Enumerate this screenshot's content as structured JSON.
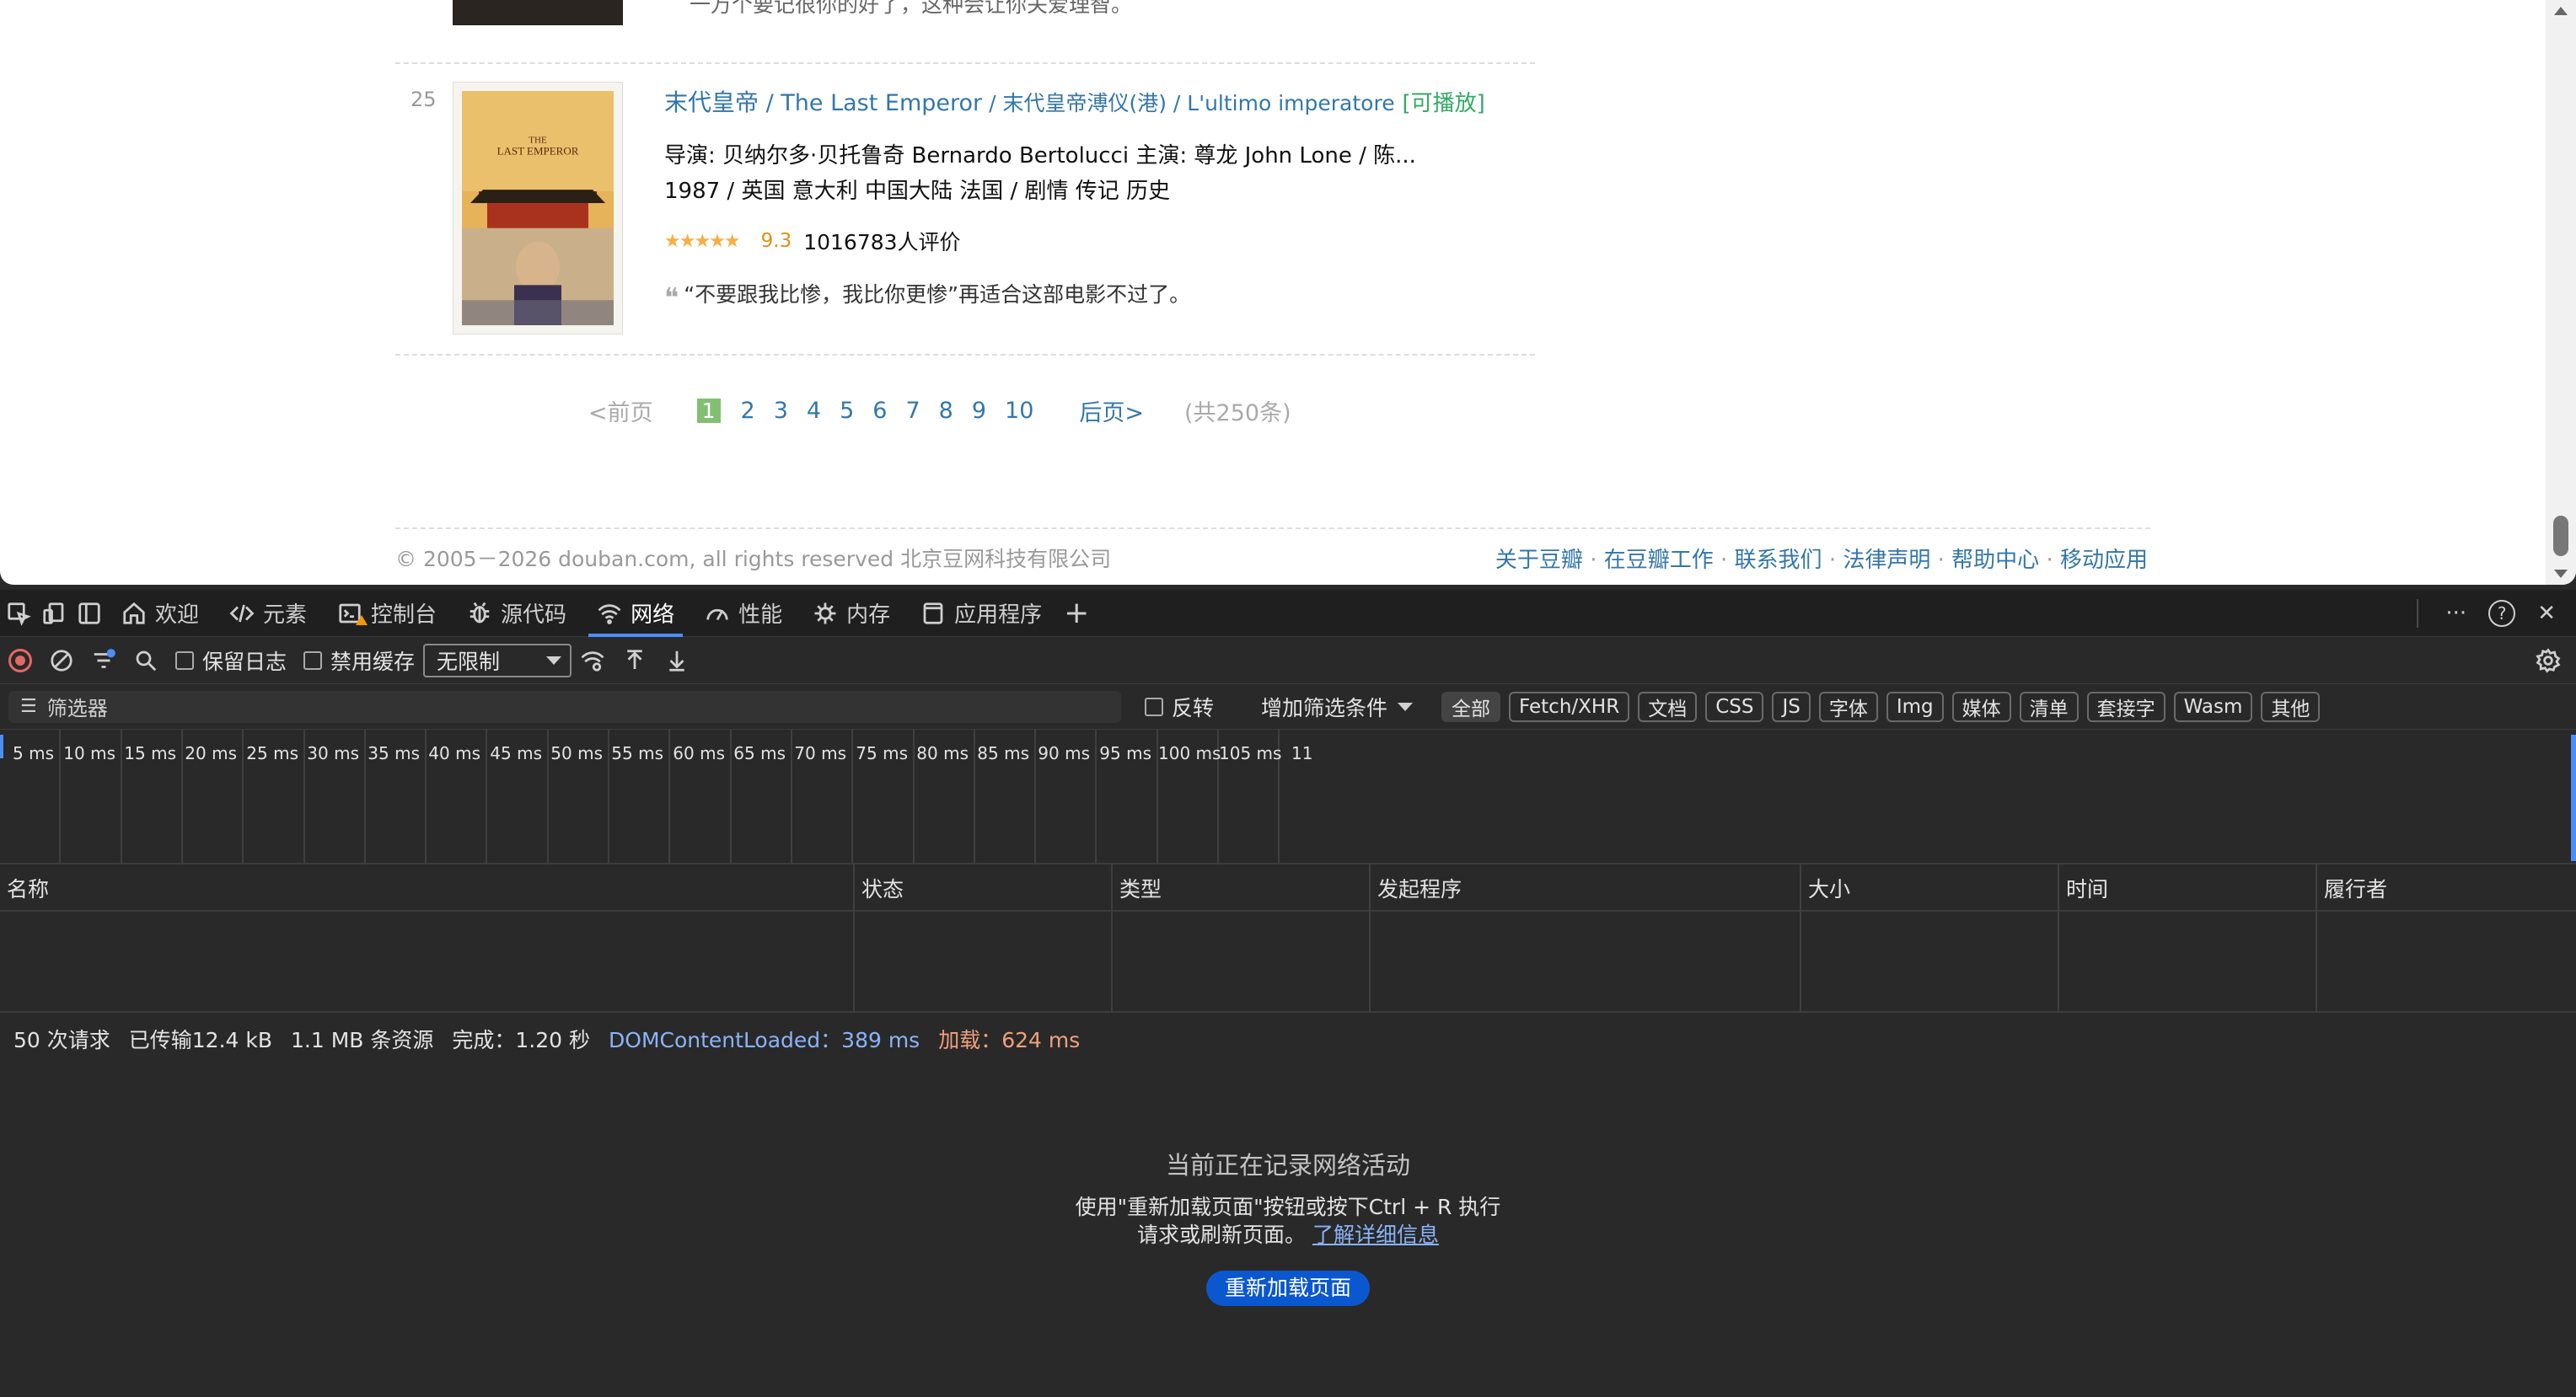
{
  "webpage": {
    "prev_item_quote": "一万个要记很你的好了，这种会让你关爱理智。",
    "item": {
      "rank": "25",
      "title_main": "末代皇帝",
      "title_alt": " / The Last Emperor",
      "title_other": " / 末代皇帝溥仪(港) / L'ultimo imperatore",
      "playable": "[可播放]",
      "director_line": "导演: 贝纳尔多·贝托鲁奇 Bernardo Bertolucci   主演: 尊龙 John Lone / 陈...",
      "meta_line": "1987 / 英国 意大利 中国大陆 法国 / 剧情 传记 历史",
      "stars": "★★★★★",
      "rating": "9.3",
      "votes": "1016783人评价",
      "quote_mark": "❝",
      "quote": "“不要跟我比惨，我比你更惨”再适合这部电影不过了。",
      "poster_text_1": "THE",
      "poster_text_2": "LAST EMPEROR"
    },
    "pager": {
      "prev": "<前页",
      "current": "1",
      "pages": [
        "2",
        "3",
        "4",
        "5",
        "6",
        "7",
        "8",
        "9",
        "10"
      ],
      "next": "后页>",
      "total": "(共250条)"
    },
    "footer": {
      "copyright": "© 2005－2026 douban.com, all rights reserved 北京豆网科技有限公司",
      "links": [
        "关于豆瓣",
        "在豆瓣工作",
        "联系我们",
        "法律声明",
        "帮助中心",
        "移动应用"
      ],
      "separator": " · "
    }
  },
  "devtools": {
    "tabs": [
      {
        "label": "欢迎",
        "icon": "home-icon"
      },
      {
        "label": "元素",
        "icon": "code-icon"
      },
      {
        "label": "控制台",
        "icon": "console-icon"
      },
      {
        "label": "源代码",
        "icon": "bug-icon"
      },
      {
        "label": "网络",
        "icon": "wifi-icon",
        "active": true
      },
      {
        "label": "性能",
        "icon": "gauge-icon"
      },
      {
        "label": "内存",
        "icon": "chip-icon"
      },
      {
        "label": "应用程序",
        "icon": "window-icon"
      }
    ],
    "add_tab": "+",
    "more": "···",
    "help": "?",
    "close": "✕",
    "toolbar": {
      "preserve_log": "保留日志",
      "disable_cache": "禁用缓存",
      "throttle": "无限制"
    },
    "filter": {
      "placeholder": "筛选器",
      "invert": "反转",
      "add_filter": "增加筛选条件",
      "chips": [
        "全部",
        "Fetch/XHR",
        "文档",
        "CSS",
        "JS",
        "字体",
        "Img",
        "媒体",
        "清单",
        "套接字",
        "Wasm",
        "其他"
      ]
    },
    "timeline_ticks": [
      "5 ms",
      "10 ms",
      "15 ms",
      "20 ms",
      "25 ms",
      "30 ms",
      "35 ms",
      "40 ms",
      "45 ms",
      "50 ms",
      "55 ms",
      "60 ms",
      "65 ms",
      "70 ms",
      "75 ms",
      "80 ms",
      "85 ms",
      "90 ms",
      "95 ms",
      "100 ms",
      "105 ms",
      "11"
    ],
    "columns": [
      "名称",
      "状态",
      "类型",
      "发起程序",
      "大小",
      "时间",
      "履行者"
    ],
    "summary": {
      "requests": "50 次请求",
      "transferred": "已传输12.4 kB",
      "resources": "1.1 MB 条资源",
      "finish": "完成：1.20 秒",
      "dcl": "DOMContentLoaded：389 ms",
      "load": "加载：624 ms"
    },
    "empty": {
      "title": "当前正在记录网络活动",
      "desc": "使用\"重新加载页面\"按钮或按下Ctrl + R 执行请求或刷新页面。",
      "link": "了解详细信息",
      "button": "重新加载页面"
    }
  },
  "colors": {
    "link": "#3377aa",
    "accent": "#4c8df6",
    "button": "#0b57d0"
  }
}
